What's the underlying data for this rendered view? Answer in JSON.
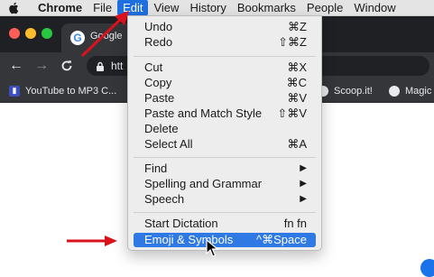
{
  "menubar": {
    "app": "Chrome",
    "items": [
      "File",
      "Edit",
      "View",
      "History",
      "Bookmarks",
      "People",
      "Window"
    ],
    "active_item": "Edit"
  },
  "tab": {
    "title": "Google"
  },
  "omnibox": {
    "url_fragment": "htt"
  },
  "bookmarks": [
    {
      "label": "YouTube to MP3 C..."
    },
    {
      "label": "Scoop.it!"
    },
    {
      "label": "Magic"
    }
  ],
  "edit_menu": {
    "undo": {
      "label": "Undo",
      "shortcut": "⌘Z"
    },
    "redo": {
      "label": "Redo",
      "shortcut": "⇧⌘Z"
    },
    "cut": {
      "label": "Cut",
      "shortcut": "⌘X"
    },
    "copy": {
      "label": "Copy",
      "shortcut": "⌘C"
    },
    "paste": {
      "label": "Paste",
      "shortcut": "⌘V"
    },
    "paste_match": {
      "label": "Paste and Match Style",
      "shortcut": "⇧⌘V"
    },
    "delete": {
      "label": "Delete"
    },
    "select_all": {
      "label": "Select All",
      "shortcut": "⌘A"
    },
    "find": {
      "label": "Find"
    },
    "spelling": {
      "label": "Spelling and Grammar"
    },
    "speech": {
      "label": "Speech"
    },
    "start_dictation": {
      "label": "Start Dictation",
      "shortcut": "fn fn"
    },
    "emoji": {
      "label": "Emoji & Symbols",
      "shortcut": "^⌘Space"
    }
  },
  "colors": {
    "menu_highlight": "#2f79e4",
    "annotation_arrow": "#d9121b",
    "menubar_active": "#1f6fe0"
  }
}
